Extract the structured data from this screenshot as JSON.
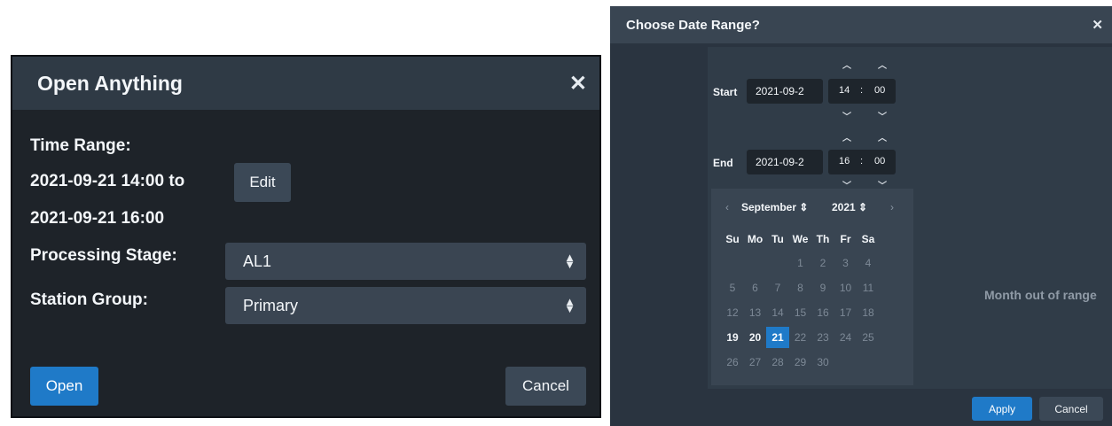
{
  "open_dialog": {
    "title": "Open Anything",
    "close_glyph": "✕",
    "time_range_label": "Time Range:",
    "time_range_start": "2021-09-21 14:00 to",
    "time_range_end": "2021-09-21 16:00",
    "edit_label": "Edit",
    "processing_stage_label": "Processing Stage:",
    "processing_stage_value": "AL1",
    "station_group_label": "Station Group:",
    "station_group_value": "Primary",
    "open_label": "Open",
    "cancel_label": "Cancel"
  },
  "date_dialog": {
    "title": "Choose Date Range?",
    "close_glyph": "✕",
    "start_label": "Start",
    "start_date": "2021-09-2",
    "start_hour": "14",
    "start_minute": "00",
    "end_label": "End",
    "end_date": "2021-09-2",
    "end_hour": "16",
    "end_minute": "00",
    "time_separator": ":",
    "calendar": {
      "prev_glyph": "‹",
      "next_glyph": "›",
      "month": "September ⇕",
      "year": "2021 ⇕",
      "weekdays": [
        "Su",
        "Mo",
        "Tu",
        "We",
        "Th",
        "Fr",
        "Sa"
      ],
      "weeks": [
        [
          "",
          "",
          "",
          "1",
          "2",
          "3",
          "4"
        ],
        [
          "5",
          "6",
          "7",
          "8",
          "9",
          "10",
          "11"
        ],
        [
          "12",
          "13",
          "14",
          "15",
          "16",
          "17",
          "18"
        ],
        [
          "19",
          "20",
          "21",
          "22",
          "23",
          "24",
          "25"
        ],
        [
          "26",
          "27",
          "28",
          "29",
          "30",
          "",
          ""
        ]
      ],
      "highlighted_days": [
        "19",
        "20"
      ],
      "selected_day": "21"
    },
    "month_out_of_range": "Month out of range",
    "apply_label": "Apply",
    "cancel_label": "Cancel"
  },
  "colors": {
    "accent": "#1f7ac8",
    "dialog_bg": "#1e2329",
    "header_bg": "#2f3a45"
  },
  "icons": [
    "close-icon",
    "chevron-up-icon",
    "chevron-down-icon",
    "sort-caret-icon",
    "chevron-left-icon",
    "chevron-right-icon"
  ]
}
